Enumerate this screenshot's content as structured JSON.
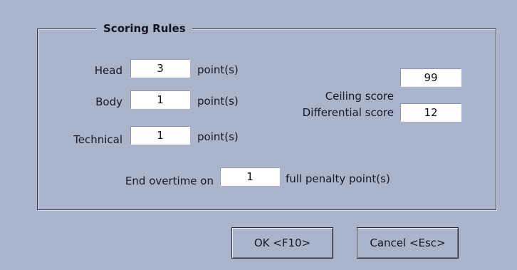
{
  "dialog": {
    "group_title": "Scoring Rules",
    "head": {
      "label": "Head",
      "value": "3",
      "unit": "point(s)"
    },
    "body": {
      "label": "Body",
      "value": "1",
      "unit": "point(s)"
    },
    "technical": {
      "label": "Technical",
      "value": "1",
      "unit": "point(s)"
    },
    "ceiling": {
      "label": "Ceiling score",
      "value": "99"
    },
    "differential": {
      "label": "Differential score",
      "value": "12"
    },
    "overtime": {
      "label": "End overtime on",
      "value": "1",
      "unit": "full penalty point(s)"
    },
    "ok_label": "OK <F10>",
    "cancel_label": "Cancel <Esc>"
  }
}
